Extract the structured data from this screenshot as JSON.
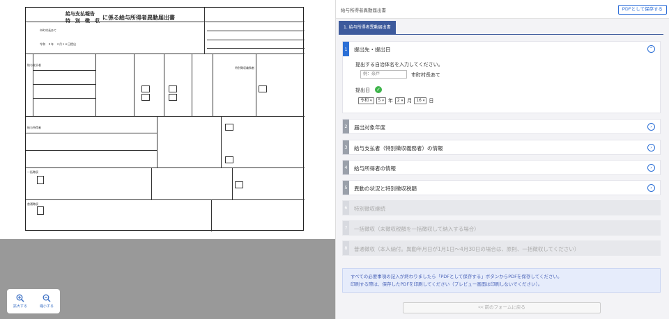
{
  "preview": {
    "form": {
      "title_line1": "給与支払報告",
      "title_line2": "特　別　徴　収",
      "title_suffix": "に係る給与所得者異動届出書",
      "date_line": "令和　５年　２月１６日提出",
      "addressee": "市町村長あて",
      "rows": [
        "給与支払者",
        "特別徴収義務者",
        "給与所得者",
        "一括徴収",
        "普通徴収"
      ]
    },
    "zoom_in_label": "拡大する",
    "zoom_out_label": "縮小する"
  },
  "panel": {
    "title": "給与所得者異動届出書",
    "save_pdf_label": "PDFとして保存する",
    "tab_label": "1. 給与所得者異動届出書",
    "sections": [
      {
        "num": "1",
        "label": "提出先・提出日",
        "state": "open"
      },
      {
        "num": "2",
        "label": "届出対象年度",
        "state": "closed"
      },
      {
        "num": "3",
        "label": "給与支払者（特別徴収義務者）の情報",
        "state": "closed"
      },
      {
        "num": "4",
        "label": "給与所得者の情報",
        "state": "closed"
      },
      {
        "num": "5",
        "label": "異動の状況と特別徴収税額",
        "state": "closed"
      },
      {
        "num": "6",
        "label": "特別徴収継続",
        "state": "disabled"
      },
      {
        "num": "7",
        "label": "一括徴収（未徴収税額を一括徴収して納入する場合）",
        "state": "disabled"
      },
      {
        "num": "8",
        "label": "普通徴収（本人納付。異動年月日が1月1日～4月30日の場合は、原則、一括徴収してください）",
        "state": "disabled"
      }
    ],
    "section1": {
      "question": "提出する自治体名を入力してください。",
      "input_placeholder": "例：奈戸",
      "input_suffix": "市町村長あて",
      "date_label": "提出日",
      "era": "令和",
      "year": "5",
      "year_unit": "年",
      "month": "2",
      "month_unit": "月",
      "day": "16",
      "day_unit": "日"
    },
    "notice_line1": "すべての必要事項の記入が終わりましたら「PDFとして保存する」ボタンからPDFを保存してください。",
    "notice_line2": "印刷する際は、保存したPDFを印刷してください（プレビュー画面は印刷しないでください）。",
    "prev_button": "<< 前のフォームに戻る"
  },
  "colors": {
    "accent": "#2b6fd6",
    "tab": "#3d5a9c",
    "success": "#3db44a"
  }
}
